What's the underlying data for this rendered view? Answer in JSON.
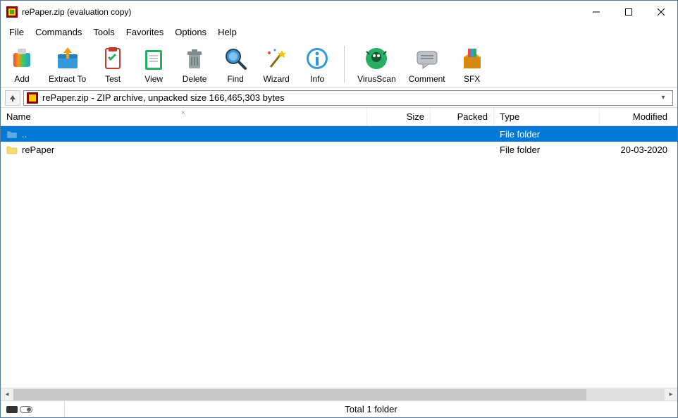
{
  "title": "rePaper.zip (evaluation copy)",
  "menu": [
    "File",
    "Commands",
    "Tools",
    "Favorites",
    "Options",
    "Help"
  ],
  "toolbar": [
    {
      "label": "Add",
      "name": "add-button"
    },
    {
      "label": "Extract To",
      "name": "extract-to-button"
    },
    {
      "label": "Test",
      "name": "test-button"
    },
    {
      "label": "View",
      "name": "view-button"
    },
    {
      "label": "Delete",
      "name": "delete-button"
    },
    {
      "label": "Find",
      "name": "find-button"
    },
    {
      "label": "Wizard",
      "name": "wizard-button"
    },
    {
      "label": "Info",
      "name": "info-button"
    }
  ],
  "toolbar2": [
    {
      "label": "VirusScan",
      "name": "virusscan-button"
    },
    {
      "label": "Comment",
      "name": "comment-button"
    },
    {
      "label": "SFX",
      "name": "sfx-button"
    }
  ],
  "address": "rePaper.zip - ZIP archive, unpacked size 166,465,303 bytes",
  "columns": {
    "name": "Name",
    "size": "Size",
    "packed": "Packed",
    "type": "Type",
    "modified": "Modified"
  },
  "rows": [
    {
      "name": "..",
      "type": "File folder",
      "modified": "",
      "selected": true,
      "icon": "parent"
    },
    {
      "name": "rePaper",
      "type": "File folder",
      "modified": "20-03-2020",
      "selected": false,
      "icon": "folder"
    }
  ],
  "status": "Total 1 folder"
}
